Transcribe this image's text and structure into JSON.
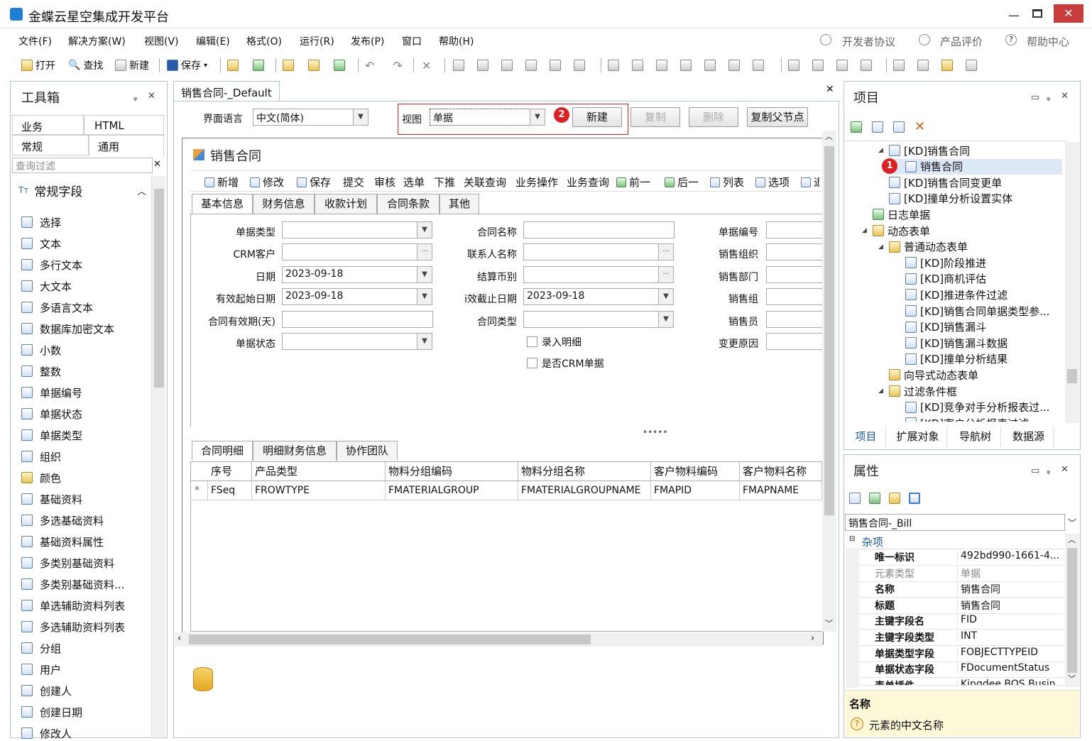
{
  "window": {
    "title": "金蝶云星空集成开发平台"
  },
  "menu": [
    "文件(F)",
    "解决方案(W)",
    "视图(V)",
    "编辑(E)",
    "格式(O)",
    "运行(R)",
    "发布(P)",
    "窗口",
    "帮助(H)"
  ],
  "menu_right": {
    "dev": "开发者协议",
    "eval": "产品评价",
    "help": "帮助中心"
  },
  "toolbar": {
    "open": "打开",
    "find": "查找",
    "new": "新建",
    "save": "保存"
  },
  "toolbox": {
    "title": "工具箱",
    "tabs": [
      "业务",
      "HTML",
      "常规",
      "通用"
    ],
    "filter_placeholder": "查询过滤",
    "section": "常规字段",
    "items": [
      "选择",
      "文本",
      "多行文本",
      "大文本",
      "多语言文本",
      "数据库加密文本",
      "小数",
      "整数",
      "单据编号",
      "单据状态",
      "单据类型",
      "组织",
      "颜色",
      "基础资料",
      "多选基础资料",
      "基础资料属性",
      "多类别基础资料",
      "多类别基础资料...",
      "单选辅助资料列表",
      "多选辅助资料列表",
      "分组",
      "用户",
      "创建人",
      "创建日期",
      "修改人"
    ]
  },
  "doc": {
    "tab": "销售合同-_Default",
    "lang_label": "界面语言",
    "lang_value": "中文(简体)",
    "view_label": "视图",
    "view_value": "单据",
    "btn_new": "新建",
    "btn_copy": "复制",
    "btn_delete": "删除",
    "btn_copy_parent": "复制父节点",
    "form_title": "销售合同",
    "form_toolbar": [
      "新增",
      "修改",
      "保存",
      "提交",
      "审核",
      "选单",
      "下推",
      "关联查询",
      "业务操作",
      "业务查询",
      "前一",
      "后一",
      "列表",
      "选项",
      "退"
    ],
    "tabs": [
      "基本信息",
      "财务信息",
      "收款计划",
      "合同条款",
      "其他"
    ],
    "fields_left": [
      {
        "label": "单据类型",
        "value": ""
      },
      {
        "label": "CRM客户",
        "value": ""
      },
      {
        "label": "日期",
        "value": "2023-09-18"
      },
      {
        "label": "有效起始日期",
        "value": "2023-09-18"
      },
      {
        "label": "合同有效期(天)",
        "value": ""
      },
      {
        "label": "单据状态",
        "value": ""
      }
    ],
    "fields_mid": [
      {
        "label": "合同名称",
        "value": ""
      },
      {
        "label": "联系人名称",
        "value": ""
      },
      {
        "label": "结算币别",
        "value": ""
      },
      {
        "label": "i效截止日期",
        "value": "2023-09-18"
      },
      {
        "label": "合同类型",
        "value": ""
      }
    ],
    "checks": [
      "录入明细",
      "是否CRM单据"
    ],
    "fields_right": [
      "单据编号",
      "销售组织",
      "销售部门",
      "销售组",
      "销售员",
      "变更原因"
    ],
    "detail_tabs": [
      "合同明细",
      "明细财务信息",
      "协作团队"
    ],
    "grid_headers": [
      "序号",
      "产品类型",
      "物料分组编码",
      "物料分组名称",
      "客户物料编码",
      "客户物料名称"
    ],
    "grid_row": [
      "*",
      "FSeq",
      "FROWTYPE",
      "FMATERIALGROUP",
      "FMATERIALGROUPNAME",
      "FMAPID",
      "FMAPNAME"
    ]
  },
  "project": {
    "title": "项目",
    "tree": [
      "[KD]销售合同",
      "销售合同",
      "[KD]销售合同变更单",
      "[KD]撞单分析设置实体",
      "日志单据",
      "动态表单",
      "普通动态表单",
      "[KD]阶段推进",
      "[KD]商机评估",
      "[KD]推进条件过滤",
      "[KD]销售合同单据类型参...",
      "[KD]销售漏斗",
      "[KD]销售漏斗数据",
      "[KD]撞单分析结果",
      "向导式动态表单",
      "过滤条件框",
      "[KD]竞争对手分析报表过...",
      "[KD]客户分析报表过滤"
    ],
    "bottom_tabs": [
      "项目",
      "扩展对象",
      "导航树",
      "数据源"
    ]
  },
  "props": {
    "title": "属性",
    "object": "销售合同-_Bill",
    "category": "杂项",
    "rows": [
      {
        "n": "唯一标识",
        "v": "492bd990-1661-4..."
      },
      {
        "n": "元素类型",
        "v": "单据"
      },
      {
        "n": "名称",
        "v": "销售合同"
      },
      {
        "n": "标题",
        "v": "销售合同"
      },
      {
        "n": "主键字段名",
        "v": "FID"
      },
      {
        "n": "主键字段类型",
        "v": "INT"
      },
      {
        "n": "单据类型字段",
        "v": "FOBJECTTYPEID"
      },
      {
        "n": "单据状态字段",
        "v": "FDocumentStatus"
      },
      {
        "n": "表单插件",
        "v": "Kingdee.BOS.Busin..."
      }
    ],
    "desc_title": "名称",
    "desc_text": "元素的中文名称"
  },
  "badges": [
    "1",
    "2"
  ]
}
